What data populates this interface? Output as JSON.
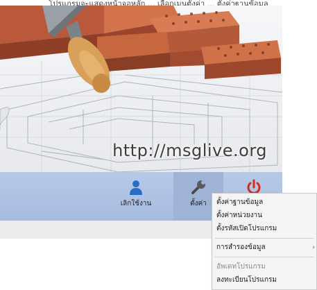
{
  "caption": "โปรแกรมจะแสดงหน้าจอหลัก ... เลือกเมนูตั้งค่า ... ตั้งค่าฐานข้อมูล",
  "hero": {
    "url_text": "http://msglive.org"
  },
  "toolbar": {
    "buttons": [
      {
        "label": "เลิกใช้งาน",
        "icon": "user-icon"
      },
      {
        "label": "ตั้งค่า",
        "icon": "wrench-icon"
      },
      {
        "label": "",
        "icon": "power-icon"
      }
    ]
  },
  "menu": {
    "items": [
      {
        "label": "ตั้งค่าฐานข้อมูล",
        "enabled": true
      },
      {
        "label": "ตั้งค่าหน่วยงาน",
        "enabled": true
      },
      {
        "label": "ตั้งรหัสเปิดโปรแกรม",
        "enabled": true
      },
      {
        "label": "การสำรองข้อมูล",
        "enabled": true,
        "submenu_glyph": "›"
      },
      {
        "label": "อัพเดทโปรแกรม",
        "enabled": false
      },
      {
        "label": "ลงทะเบียนโปรแกรม",
        "enabled": true
      }
    ]
  },
  "colors": {
    "toolbar": "#a7bbdf",
    "user_icon": "#2b6cc4",
    "power_icon": "#d62a1e",
    "brick": "#c8663f"
  }
}
